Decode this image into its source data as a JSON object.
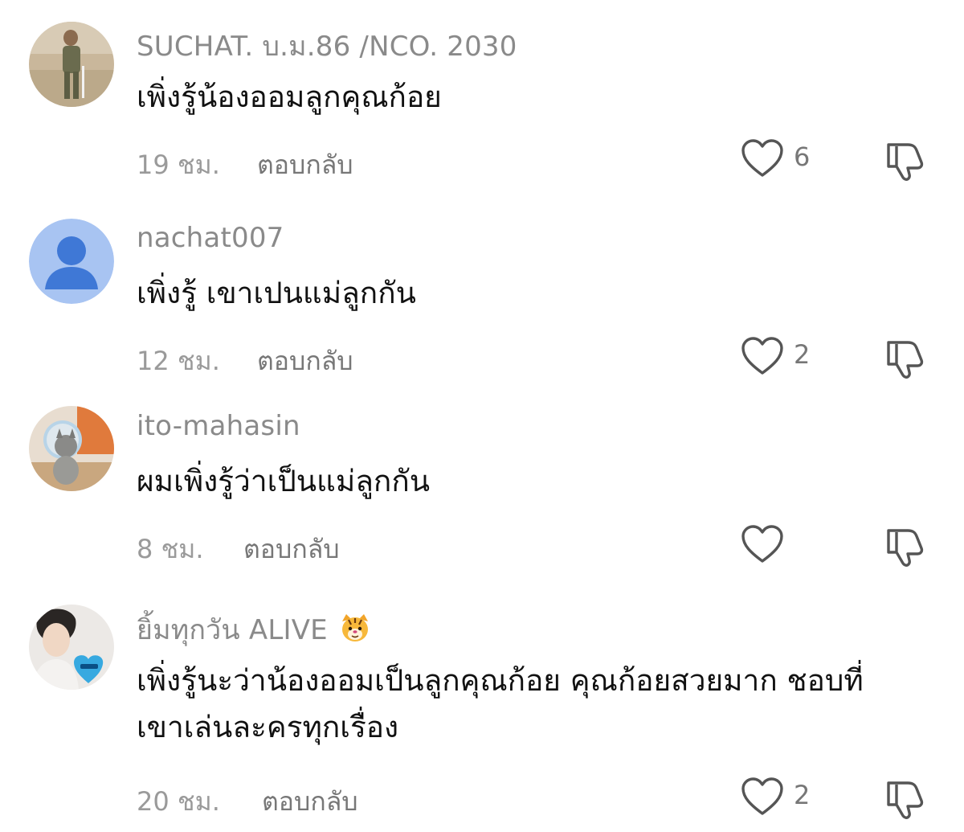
{
  "comments": [
    {
      "username": "SUCHAT. บ.ม.86 /NCO. 2030",
      "text": "เพิ่งรู้น้องออมลูกคุณก้อย",
      "time": "19 ชม.",
      "reply_label": "ตอบกลับ",
      "likes": "6",
      "avatar_icon": "soldier-photo-avatar"
    },
    {
      "username": "nachat007",
      "text": "เพิ่งรู้ เขาเปนแม่ลูกกัน",
      "time": "12 ชม.",
      "reply_label": "ตอบกลับ",
      "likes": "2",
      "avatar_icon": "default-person-avatar",
      "avatar_color": "#4a86e8"
    },
    {
      "username": "ito-mahasin",
      "text": "ผมเพิ่งรู้ว่าเป็นแม่ลูกกัน",
      "time": "8 ชม.",
      "reply_label": "ตอบกลับ",
      "likes": "",
      "avatar_icon": "cat-photo-avatar"
    },
    {
      "username": "ยิ้มทุกวัน ALIVE",
      "username_emoji": "tiger-face-emoji",
      "text": "เพิ่งรู้นะว่าน้องออมเป็นลูกคุณก้อย คุณก้อยสวยมาก ชอบที่เขาเล่นละครทุกเรื่อง",
      "time": "20 ชม.",
      "reply_label": "ตอบกลับ",
      "likes": "2",
      "avatar_icon": "person-with-heart-photo-avatar"
    }
  ],
  "icons": {
    "like": "heart-outline-icon",
    "dislike": "thumbs-down-outline-icon"
  }
}
